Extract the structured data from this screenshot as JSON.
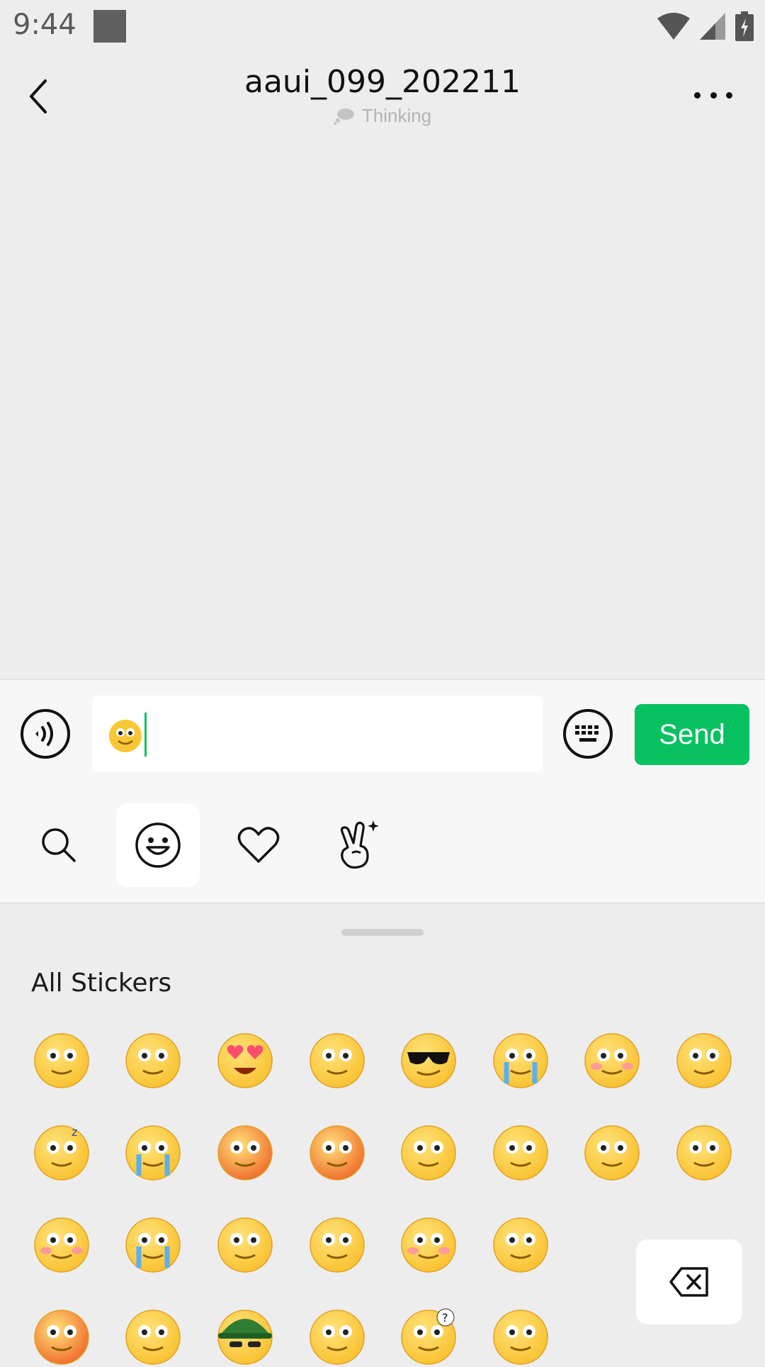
{
  "status": {
    "time": "9:44"
  },
  "header": {
    "title": "aaui_099_202211",
    "subtitle": "Thinking"
  },
  "input": {
    "send_label": "Send"
  },
  "tabs": [
    "search-icon",
    "emoji-icon",
    "heart-icon",
    "gesture-icon"
  ],
  "panel": {
    "title": "All Stickers"
  },
  "stickers": [
    "smile",
    "awkward",
    "heart-eyes",
    "stare",
    "cool",
    "cry",
    "shy",
    "shut-mouth",
    "sleep",
    "tears-laugh",
    "angry-sweat",
    "furious",
    "tongue",
    "grin",
    "surprised",
    "sad",
    "blush",
    "laugh",
    "sick",
    "facepalm",
    "happy",
    "shocked",
    "scream",
    "beam",
    "helmet",
    "lol",
    "question",
    "hush"
  ]
}
